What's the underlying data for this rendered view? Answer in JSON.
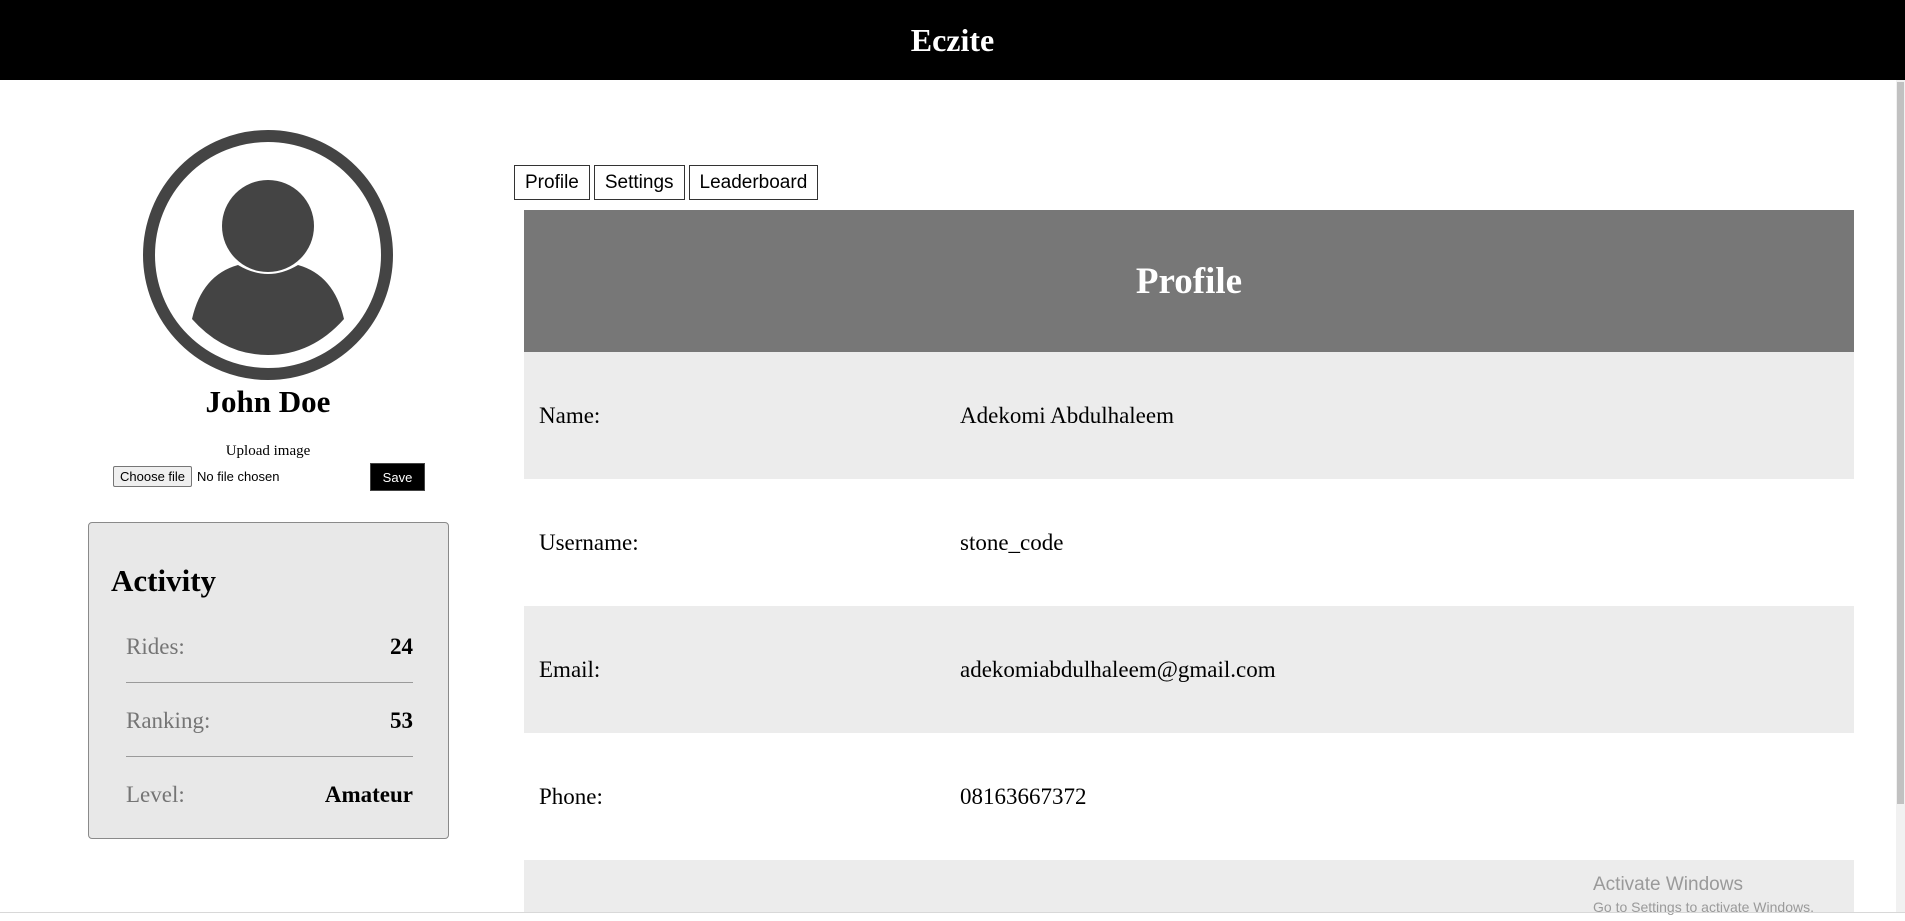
{
  "header": {
    "brand": "Eczite"
  },
  "user": {
    "display_name": "John Doe",
    "upload_label": "Upload image",
    "choose_file_label": "Choose file",
    "file_status": "No file chosen",
    "save_label": "Save"
  },
  "activity": {
    "title": "Activity",
    "items": [
      {
        "label": "Rides:",
        "value": "24"
      },
      {
        "label": "Ranking:",
        "value": "53"
      },
      {
        "label": "Level:",
        "value": "Amateur"
      }
    ]
  },
  "tabs": [
    {
      "label": "Profile"
    },
    {
      "label": "Settings"
    },
    {
      "label": "Leaderboard"
    }
  ],
  "profile": {
    "title": "Profile",
    "fields": [
      {
        "label": "Name:",
        "value": "Adekomi Abdulhaleem"
      },
      {
        "label": "Username:",
        "value": "stone_code"
      },
      {
        "label": "Email:",
        "value": "adekomiabdulhaleem@gmail.com"
      },
      {
        "label": "Phone:",
        "value": "08163667372"
      }
    ]
  },
  "watermark": {
    "title": "Activate Windows",
    "subtitle": "Go to Settings to activate Windows."
  },
  "colors": {
    "topbar": "#000000",
    "panel_header": "#777777",
    "row_shaded": "#ececec",
    "activity_bg": "#e8e8e8",
    "avatar": "#444444"
  },
  "icons": {
    "avatar": "user-avatar-icon"
  }
}
